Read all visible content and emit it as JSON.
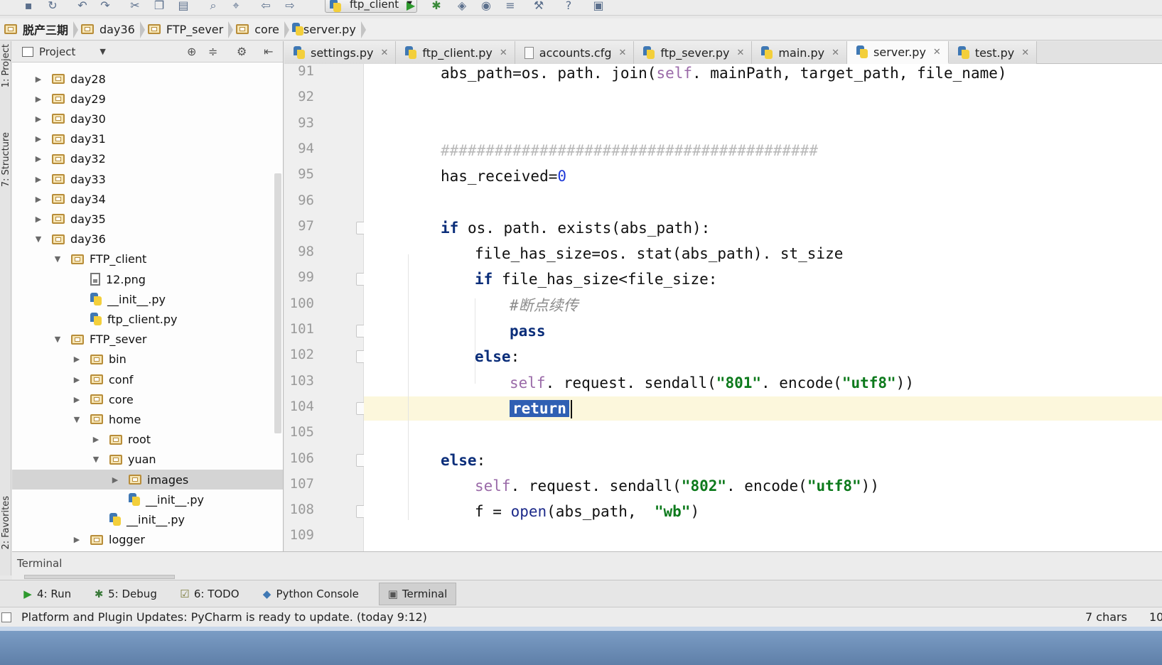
{
  "toolbar": {
    "run_config": "ftp_client",
    "icons": [
      "save-icon",
      "sync-icon",
      "undo-icon",
      "redo-icon",
      "cut-icon",
      "copy-icon",
      "paste-icon",
      "find-icon",
      "replace-icon",
      "back-icon",
      "forward-icon",
      "run-icon",
      "debug-icon",
      "coverage-icon",
      "profile-icon",
      "build-icon",
      "settings-icon",
      "help-icon",
      "sdk-icon"
    ]
  },
  "breadcrumb": [
    "脱产三期",
    "day36",
    "FTP_sever",
    "core",
    "server.py"
  ],
  "left_stripe": {
    "project": "1: Project",
    "structure": "7: Structure",
    "favorites": "2: Favorites"
  },
  "project_panel": {
    "title": "Project",
    "tree": [
      {
        "label": "day28",
        "type": "folder",
        "depth": 0,
        "expanded": false
      },
      {
        "label": "day29",
        "type": "folder",
        "depth": 0,
        "expanded": false
      },
      {
        "label": "day30",
        "type": "folder",
        "depth": 0,
        "expanded": false
      },
      {
        "label": "day31",
        "type": "folder",
        "depth": 0,
        "expanded": false
      },
      {
        "label": "day32",
        "type": "folder",
        "depth": 0,
        "expanded": false
      },
      {
        "label": "day33",
        "type": "folder",
        "depth": 0,
        "expanded": false
      },
      {
        "label": "day34",
        "type": "folder",
        "depth": 0,
        "expanded": false
      },
      {
        "label": "day35",
        "type": "folder",
        "depth": 0,
        "expanded": false
      },
      {
        "label": "day36",
        "type": "folder",
        "depth": 0,
        "expanded": true
      },
      {
        "label": "FTP_client",
        "type": "folder",
        "depth": 1,
        "expanded": true
      },
      {
        "label": "12.png",
        "type": "image",
        "depth": 2
      },
      {
        "label": "__init__.py",
        "type": "python",
        "depth": 2
      },
      {
        "label": "ftp_client.py",
        "type": "python",
        "depth": 2
      },
      {
        "label": "FTP_sever",
        "type": "folder",
        "depth": 1,
        "expanded": true
      },
      {
        "label": "bin",
        "type": "folder",
        "depth": 2,
        "expanded": false
      },
      {
        "label": "conf",
        "type": "folder",
        "depth": 2,
        "expanded": false
      },
      {
        "label": "core",
        "type": "folder",
        "depth": 2,
        "expanded": false
      },
      {
        "label": "home",
        "type": "folder",
        "depth": 2,
        "expanded": true
      },
      {
        "label": "root",
        "type": "folder",
        "depth": 3,
        "expanded": false
      },
      {
        "label": "yuan",
        "type": "folder",
        "depth": 3,
        "expanded": true
      },
      {
        "label": "images",
        "type": "folder",
        "depth": 4,
        "expanded": false,
        "selected": true
      },
      {
        "label": "__init__.py",
        "type": "python",
        "depth": 4
      },
      {
        "label": "__init__.py",
        "type": "python",
        "depth": 3
      },
      {
        "label": "logger",
        "type": "folder",
        "depth": 2,
        "expanded": false
      }
    ]
  },
  "editor": {
    "tabs": [
      {
        "label": "settings.py",
        "icon": "python-file-icon"
      },
      {
        "label": "ftp_client.py",
        "icon": "python-file-icon"
      },
      {
        "label": "accounts.cfg",
        "icon": "config-file-icon"
      },
      {
        "label": "ftp_sever.py",
        "icon": "python-file-icon"
      },
      {
        "label": "main.py",
        "icon": "python-file-icon"
      },
      {
        "label": "server.py",
        "icon": "python-file-icon",
        "active": true
      },
      {
        "label": "test.py",
        "icon": "python-file-icon"
      }
    ],
    "current_line": 104,
    "lines": [
      {
        "n": 91,
        "indent": 2,
        "tokens": [
          {
            "t": "abs_path=os. path. join("
          },
          {
            "t": "self",
            "c": "self"
          },
          {
            "t": ". mainPath, target_path, file_name)"
          }
        ]
      },
      {
        "n": 92,
        "indent": 0,
        "tokens": []
      },
      {
        "n": 93,
        "indent": 0,
        "tokens": []
      },
      {
        "n": 94,
        "indent": 2,
        "tokens": [
          {
            "t": "##########################################",
            "c": "hashline"
          }
        ]
      },
      {
        "n": 95,
        "indent": 2,
        "tokens": [
          {
            "t": "has_received="
          },
          {
            "t": "0",
            "c": "num"
          }
        ]
      },
      {
        "n": 96,
        "indent": 0,
        "tokens": []
      },
      {
        "n": 97,
        "indent": 2,
        "fold": true,
        "tokens": [
          {
            "t": "if",
            "c": "kw"
          },
          {
            "t": " os. path. exists(abs_path):"
          }
        ]
      },
      {
        "n": 98,
        "indent": 3,
        "tokens": [
          {
            "t": "file_has_size=os. stat(abs_path). st_size"
          }
        ]
      },
      {
        "n": 99,
        "indent": 3,
        "fold": true,
        "tokens": [
          {
            "t": "if",
            "c": "kw"
          },
          {
            "t": " file_has_size<file_size:"
          }
        ]
      },
      {
        "n": 100,
        "indent": 4,
        "tokens": [
          {
            "t": "#断点续传",
            "c": "cmt"
          }
        ]
      },
      {
        "n": 101,
        "indent": 4,
        "fold": true,
        "tokens": [
          {
            "t": "pass",
            "c": "kw"
          }
        ]
      },
      {
        "n": 102,
        "indent": 3,
        "fold": true,
        "tokens": [
          {
            "t": "else",
            "c": "kw"
          },
          {
            "t": ":"
          }
        ]
      },
      {
        "n": 103,
        "indent": 4,
        "tokens": [
          {
            "t": "self",
            "c": "self"
          },
          {
            "t": ". request. sendall("
          },
          {
            "t": "\"801\"",
            "c": "str"
          },
          {
            "t": ". encode("
          },
          {
            "t": "\"utf8\"",
            "c": "str"
          },
          {
            "t": "))"
          }
        ]
      },
      {
        "n": 104,
        "indent": 4,
        "fold": true,
        "tokens": [
          {
            "t": "return",
            "c": "selected"
          }
        ]
      },
      {
        "n": 105,
        "indent": 0,
        "tokens": []
      },
      {
        "n": 106,
        "indent": 2,
        "fold": true,
        "tokens": [
          {
            "t": "else",
            "c": "kw"
          },
          {
            "t": ":"
          }
        ]
      },
      {
        "n": 107,
        "indent": 3,
        "tokens": [
          {
            "t": "self",
            "c": "self"
          },
          {
            "t": ". request. sendall("
          },
          {
            "t": "\"802\"",
            "c": "str"
          },
          {
            "t": ". encode("
          },
          {
            "t": "\"utf8\"",
            "c": "str"
          },
          {
            "t": "))"
          }
        ]
      },
      {
        "n": 108,
        "indent": 3,
        "fold": true,
        "tokens": [
          {
            "t": "f = "
          },
          {
            "t": "open",
            "c": "builtin"
          },
          {
            "t": "(abs_path,  "
          },
          {
            "t": "\"wb\"",
            "c": "str"
          },
          {
            "t": ")"
          }
        ]
      },
      {
        "n": 109,
        "indent": 0,
        "tokens": []
      }
    ]
  },
  "terminal": {
    "title": "Terminal"
  },
  "tool_tabs": [
    {
      "label": "4: Run",
      "icon": "run-icon"
    },
    {
      "label": "5: Debug",
      "icon": "debug-icon"
    },
    {
      "label": "6: TODO",
      "icon": "todo-icon"
    },
    {
      "label": "Python Console",
      "icon": "python-console-icon"
    },
    {
      "label": "Terminal",
      "icon": "terminal-icon",
      "active": true
    }
  ],
  "status_bar": {
    "message": "Platform and Plugin Updates: PyCharm is ready to update. (today 9:12)",
    "chars": "7 chars",
    "position": "10"
  }
}
